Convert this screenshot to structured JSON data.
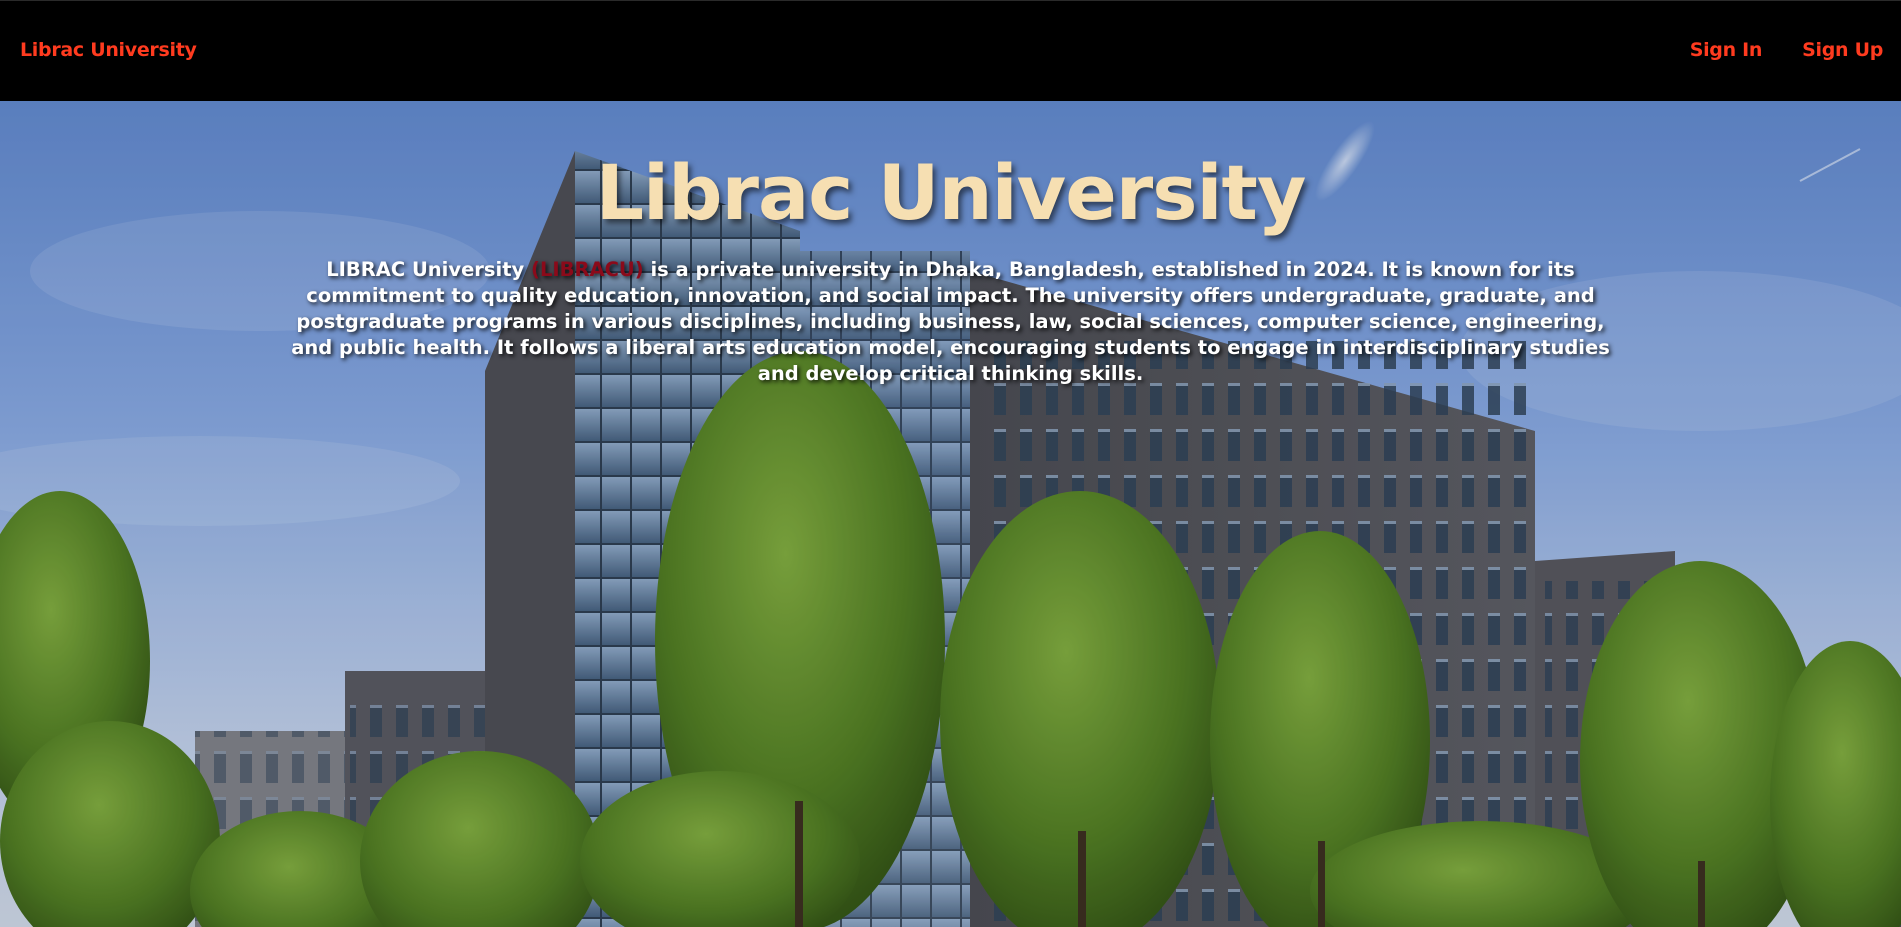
{
  "nav": {
    "brand": "Librac University",
    "links": [
      {
        "label": "Sign In"
      },
      {
        "label": "Sign Up"
      }
    ]
  },
  "hero": {
    "title": "Librac University",
    "description": {
      "name": "LIBRAC University",
      "abbr": "(LIBRACU)",
      "rest": "is a private university in Dhaka, Bangladesh, established in 2024. It is known for its commitment to quality education, innovation, and social impact. The university offers undergraduate, graduate, and postgraduate programs in various disciplines, including business, law, social sciences, computer science, engineering, and public health. It follows a liberal arts education model, encouraging students to engage in interdisciplinary studies and develop critical thinking skills."
    },
    "background_image": "university-building-photo"
  },
  "colors": {
    "nav_bg": "#000000",
    "nav_link": "#ff3b1f",
    "hero_title": "#f6dfb2",
    "hero_text": "#ffffff",
    "abbr": "#8b0a1a"
  }
}
